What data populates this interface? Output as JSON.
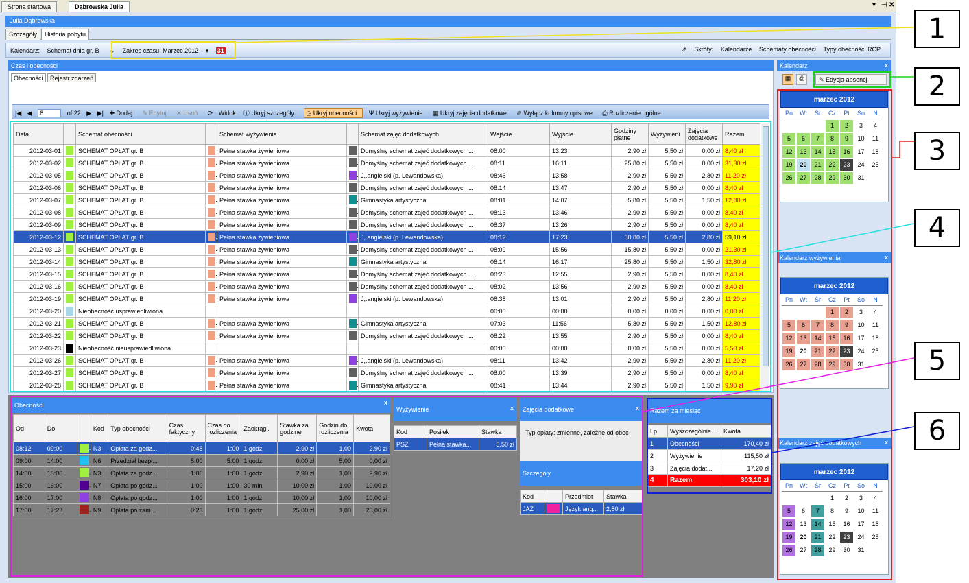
{
  "window": {
    "tabs": [
      "Strona startowa",
      "Dąbrowska Julia"
    ],
    "user": "Julia Dąbrowska",
    "subtabs": [
      "Szczegóły",
      "Historia pobytu"
    ]
  },
  "toolbar": {
    "kalendarz_label": "Kalendarz:",
    "kalendarz_value": "Schemat dnia gr. B",
    "zakres": "Zakres czasu: Marzec 2012",
    "skroty": "Skróty:",
    "kalendarze": "Kalendarze",
    "schematy": "Schematy obecności",
    "typy": "Typy obecności RCP"
  },
  "czas": {
    "title": "Czas i obecności",
    "tabs": [
      "Obecności",
      "Rejestr zdarzeń"
    ]
  },
  "gridtb": {
    "page": "8",
    "of": "of 22",
    "dodaj": "Dodaj",
    "edytuj": "Edytuj",
    "usun": "Usuń",
    "widok": "Widok:",
    "ukryj_szcz": "Ukryj szczegóły",
    "ukryj_obec": "Ukryj obecności",
    "ukryj_zyw": "Ukryj wyżywienie",
    "ukryj_zaj": "Ukryj zajęcia dodatkowe",
    "wylacz": "Wyłącz kolumny opisowe",
    "rozliczenie": "Rozliczenie ogólne"
  },
  "main_headers": [
    "Data",
    "Schemat obecności",
    "Schemat wyżywienia",
    "Schemat zajęć dodatkowych",
    "Wejście",
    "Wyjście",
    "Godziny płatne",
    "Wyżywieni",
    "Zajęcia dodatkowe",
    "Razem"
  ],
  "main_rows": [
    [
      "2012-03-01",
      "#a0f040",
      "SCHEMAT OPŁAT gr. B",
      "#f0a080",
      "Pełna stawka żywieniowa",
      "#606060",
      "Domyślny schemat zajęć dodatkowych ...",
      "08:00",
      "13:23",
      "2,90 zł",
      "5,50 zł",
      "0,00 zł",
      "8,40 zł"
    ],
    [
      "2012-03-02",
      "#a0f040",
      "SCHEMAT OPŁAT gr. B",
      "#f0a080",
      "Pełna stawka żywieniowa",
      "#606060",
      "Domyślny schemat zajęć dodatkowych ...",
      "08:11",
      "16:11",
      "25,80 zł",
      "5,50 zł",
      "0,00 zł",
      "31,30 zł"
    ],
    [
      "2012-03-05",
      "#a0f040",
      "SCHEMAT OPŁAT gr. B",
      "#f0a080",
      "Pełna stawka żywieniowa",
      "#9040e0",
      "J,.angielski (p. Lewandowska)",
      "08:46",
      "13:58",
      "2,90 zł",
      "5,50 zł",
      "2,80 zł",
      "11,20 zł"
    ],
    [
      "2012-03-06",
      "#a0f040",
      "SCHEMAT OPŁAT gr. B",
      "#f0a080",
      "Pełna stawka żywieniowa",
      "#606060",
      "Domyślny schemat zajęć dodatkowych ...",
      "08:14",
      "13:47",
      "2,90 zł",
      "5,50 zł",
      "0,00 zł",
      "8,40 zł"
    ],
    [
      "2012-03-07",
      "#a0f040",
      "SCHEMAT OPŁAT gr. B",
      "#f0a080",
      "Pełna stawka żywieniowa",
      "#109090",
      "Gimnastyka artystyczna",
      "08:01",
      "14:07",
      "5,80 zł",
      "5,50 zł",
      "1,50 zł",
      "12,80 zł"
    ],
    [
      "2012-03-08",
      "#a0f040",
      "SCHEMAT OPŁAT gr. B",
      "#f0a080",
      "Pełna stawka żywieniowa",
      "#606060",
      "Domyślny schemat zajęć dodatkowych ...",
      "08:13",
      "13:46",
      "2,90 zł",
      "5,50 zł",
      "0,00 zł",
      "8,40 zł"
    ],
    [
      "2012-03-09",
      "#a0f040",
      "SCHEMAT OPŁAT gr. B",
      "#f0a080",
      "Pełna stawka żywieniowa",
      "#606060",
      "Domyślny schemat zajęć dodatkowych ...",
      "08:37",
      "13:26",
      "2,90 zł",
      "5,50 zł",
      "0,00 zł",
      "8,40 zł"
    ],
    [
      "2012-03-12",
      "#a0f040",
      "SCHEMAT OPŁAT gr. B",
      "#f0a080",
      "Pełna stawka żywieniowa",
      "#9040e0",
      "J,.angielski (p. Lewandowska)",
      "08:12",
      "17:23",
      "50,80 zł",
      "5,50 zł",
      "2,80 zł",
      "59,10 zł"
    ],
    [
      "2012-03-13",
      "#a0f040",
      "SCHEMAT OPŁAT gr. B",
      "#f0a080",
      "Pełna stawka żywieniowa",
      "#606060",
      "Domyślny schemat zajęć dodatkowych ...",
      "08:09",
      "15:56",
      "15,80 zł",
      "5,50 zł",
      "0,00 zł",
      "21,30 zł"
    ],
    [
      "2012-03-14",
      "#a0f040",
      "SCHEMAT OPŁAT gr. B",
      "#f0a080",
      "Pełna stawka żywieniowa",
      "#109090",
      "Gimnastyka artystyczna",
      "08:14",
      "16:17",
      "25,80 zł",
      "5,50 zł",
      "1,50 zł",
      "32,80 zł"
    ],
    [
      "2012-03-15",
      "#a0f040",
      "SCHEMAT OPŁAT gr. B",
      "#f0a080",
      "Pełna stawka żywieniowa",
      "#606060",
      "Domyślny schemat zajęć dodatkowych ...",
      "08:23",
      "12:55",
      "2,90 zł",
      "5,50 zł",
      "0,00 zł",
      "8,40 zł"
    ],
    [
      "2012-03-16",
      "#a0f040",
      "SCHEMAT OPŁAT gr. B",
      "#f0a080",
      "Pełna stawka żywieniowa",
      "#606060",
      "Domyślny schemat zajęć dodatkowych ...",
      "08:02",
      "13:56",
      "2,90 zł",
      "5,50 zł",
      "0,00 zł",
      "8,40 zł"
    ],
    [
      "2012-03-19",
      "#a0f040",
      "SCHEMAT OPŁAT gr. B",
      "#f0a080",
      "Pełna stawka żywieniowa",
      "#9040e0",
      "J,.angielski (p. Lewandowska)",
      "08:38",
      "13:01",
      "2,90 zł",
      "5,50 zł",
      "2,80 zł",
      "11,20 zł"
    ],
    [
      "2012-03-20",
      "#a8d8e8",
      "Nieobecność usprawiedliwiona",
      "",
      "",
      "",
      "",
      "00:00",
      "00:00",
      "0,00 zł",
      "0,00 zł",
      "0,00 zł",
      "0,00 zł"
    ],
    [
      "2012-03-21",
      "#a0f040",
      "SCHEMAT OPŁAT gr. B",
      "#f0a080",
      "Pełna stawka żywieniowa",
      "#109090",
      "Gimnastyka artystyczna",
      "07:03",
      "11:56",
      "5,80 zł",
      "5,50 zł",
      "1,50 zł",
      "12,80 zł"
    ],
    [
      "2012-03-22",
      "#a0f040",
      "SCHEMAT OPŁAT gr. B",
      "#f0a080",
      "Pełna stawka żywieniowa",
      "#606060",
      "Domyślny schemat zajęć dodatkowych ...",
      "08:22",
      "13:55",
      "2,90 zł",
      "5,50 zł",
      "0,00 zł",
      "8,40 zł"
    ],
    [
      "2012-03-23",
      "#000000",
      "Nieobecność nieusprawiedliwiona",
      "",
      "",
      "",
      "",
      "00:00",
      "00:00",
      "0,00 zł",
      "5,50 zł",
      "0,00 zł",
      "5,50 zł"
    ],
    [
      "2012-03-26",
      "#a0f040",
      "SCHEMAT OPŁAT gr. B",
      "#f0a080",
      "Pełna stawka żywieniowa",
      "#9040e0",
      "J,.angielski (p. Lewandowska)",
      "08:11",
      "13:42",
      "2,90 zł",
      "5,50 zł",
      "2,80 zł",
      "11,20 zł"
    ],
    [
      "2012-03-27",
      "#a0f040",
      "SCHEMAT OPŁAT gr. B",
      "#f0a080",
      "Pełna stawka żywieniowa",
      "#606060",
      "Domyślny schemat zajęć dodatkowych ...",
      "08:00",
      "13:39",
      "2,90 zł",
      "5,50 zł",
      "0,00 zł",
      "8,40 zł"
    ],
    [
      "2012-03-28",
      "#a0f040",
      "SCHEMAT OPŁAT gr. B",
      "#f0a080",
      "Pełna stawka żywieniowa",
      "#109090",
      "Gimnastyka artystyczna",
      "08:41",
      "13:44",
      "2,90 zł",
      "5,50 zł",
      "1,50 zł",
      "9,90 zł"
    ]
  ],
  "selected_row": 7,
  "obec": {
    "title": "Obecności",
    "headers": [
      "Od",
      "Do",
      "",
      "Kod",
      "Typ obecności",
      "Czas faktyczny",
      "Czas do rozliczenia",
      "Zaokrągl.",
      "Stawka za godzinę",
      "Godzin do rozliczenia",
      "Kwota"
    ],
    "rows": [
      [
        "08:12",
        "09:00",
        "#a0f040",
        "N3",
        "Opłata za godz...",
        "0:48",
        "1:00",
        "1 godz.",
        "2,90 zł",
        "1,00",
        "2,90 zł"
      ],
      [
        "09:00",
        "14:00",
        "#20c0f0",
        "N6",
        "Przedział bezpł...",
        "5:00",
        "5:00",
        "1 godz.",
        "0,00 zł",
        "5,00",
        "0,00 zł"
      ],
      [
        "14:00",
        "15:00",
        "#a0f040",
        "N3",
        "Opłata za godz...",
        "1:00",
        "1:00",
        "1 godz.",
        "2,90 zł",
        "1,00",
        "2,90 zł"
      ],
      [
        "15:00",
        "16:00",
        "#500090",
        "N7",
        "Opłata po godz...",
        "1:00",
        "1:00",
        "30 min.",
        "10,00 zł",
        "1,00",
        "10,00 zł"
      ],
      [
        "16:00",
        "17:00",
        "#9040e0",
        "N8",
        "Opłata po godz...",
        "1:00",
        "1:00",
        "1 godz.",
        "10,00 zł",
        "1,00",
        "10,00 zł"
      ],
      [
        "17:00",
        "17:23",
        "#a02020",
        "N9",
        "Opłata po zam...",
        "0:23",
        "1:00",
        "1 godz.",
        "25,00 zł",
        "1,00",
        "25,00 zł"
      ]
    ]
  },
  "zyw": {
    "title": "Wyżywienie",
    "headers": [
      "Kod",
      "Posiłek",
      "Stawka"
    ],
    "rows": [
      [
        "PSZ",
        "Pełna stawka...",
        "5,50 zł"
      ]
    ]
  },
  "zaj": {
    "title": "Zajęcia dodatkowe",
    "typ_label": "Typ opłaty:",
    "typ_value": "zmienne, zależne od obec",
    "szcz_title": "Szczegóły",
    "headers": [
      "Kod",
      "",
      "Przedmiot",
      "Stawka"
    ],
    "rows": [
      [
        "JAZ",
        "#f020a0",
        "Język ang...",
        "2,80 zł"
      ]
    ]
  },
  "razem": {
    "title": "Razem za miesiąc",
    "headers": [
      "Lp.",
      "Wyszczególnienie",
      "Kwota"
    ],
    "rows": [
      [
        "1",
        "Obecności",
        "170,40 zł"
      ],
      [
        "2",
        "Wyżywienie",
        "115,50 zł"
      ],
      [
        "3",
        "Zajęcia dodat...",
        "17,20 zł"
      ]
    ],
    "total": [
      "4",
      "Razem",
      "303,10 zł"
    ]
  },
  "right": {
    "kal_title": "Kalendarz",
    "edycja": "Edycja absencji",
    "kal_zyw_title": "Kalendarz wyżywienia",
    "kal_zaj_title": "Kalendarz zajęć dodatkowych",
    "month": "marzec 2012",
    "days": [
      "Pn",
      "Wt",
      "Śr",
      "Cz",
      "Pt",
      "So",
      "N"
    ]
  },
  "cal_colors": {
    "cal1": {
      "1": "#a0e070",
      "2": "#a0e070",
      "5": "#a0e070",
      "6": "#a0e070",
      "7": "#a0e070",
      "8": "#a0e070",
      "9": "#a0e070",
      "12": "#a0e070",
      "13": "#a0e070",
      "14": "#a0e070",
      "15": "#a0e070",
      "16": "#a0e070",
      "19": "#a0e070",
      "20": "#c0e0f0",
      "21": "#a0e070",
      "22": "#a0e070",
      "23": "#404040",
      "26": "#a0e070",
      "27": "#a0e070",
      "28": "#a0e070",
      "29": "#a0e070",
      "30": "#a0e070"
    },
    "cal2": {
      "1": "#e8a090",
      "2": "#e8a090",
      "5": "#e8a090",
      "6": "#e8a090",
      "7": "#e8a090",
      "8": "#e8a090",
      "9": "#e8a090",
      "12": "#e8a090",
      "13": "#e8a090",
      "14": "#e8a090",
      "15": "#e8a090",
      "16": "#e8a090",
      "19": "#e8a090",
      "21": "#e8a090",
      "22": "#e8a090",
      "23": "#404040",
      "26": "#e8a090",
      "27": "#e8a090",
      "28": "#e8a090",
      "29": "#e8a090",
      "30": "#e8a090"
    },
    "cal3": {
      "5": "#b070e0",
      "7": "#40a0a0",
      "12": "#b070e0",
      "14": "#40a0a0",
      "19": "#b070e0",
      "21": "#40a0a0",
      "23": "#404040",
      "26": "#b070e0",
      "28": "#40a0a0"
    }
  },
  "callouts": [
    "1",
    "2",
    "3",
    "4",
    "5",
    "6"
  ]
}
